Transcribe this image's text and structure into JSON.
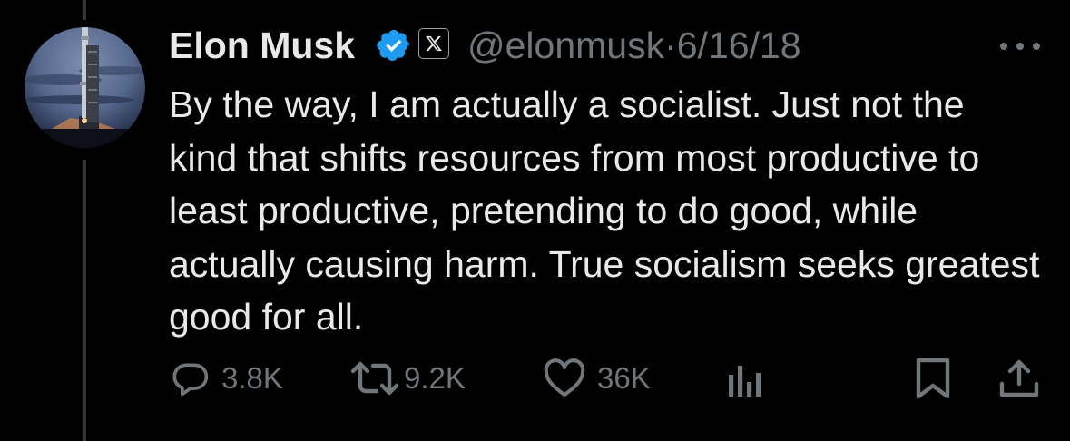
{
  "tweet": {
    "author_name": "Elon Musk",
    "handle_line": "@elonmusk·6/16/18",
    "text": "By the way, I am actually a socialist. Just not the kind that shifts resources from most productive to least productive, pretending to do good, while actually causing harm. True socialism seeks greatest good for all."
  },
  "actions": {
    "replies": "3.8K",
    "reposts": "9.2K",
    "likes": "36K"
  },
  "icons": {
    "verified": "verified-badge-icon",
    "affiliate": "x-logo-icon",
    "more": "more-options-icon",
    "reply": "reply-icon",
    "repost": "repost-icon",
    "like": "heart-icon",
    "views": "views-icon",
    "bookmark": "bookmark-icon",
    "share": "share-icon"
  },
  "colors": {
    "background": "#000000",
    "text_primary": "#e7e9ea",
    "text_secondary": "#71767b",
    "verified_blue": "#1d9bf0"
  }
}
